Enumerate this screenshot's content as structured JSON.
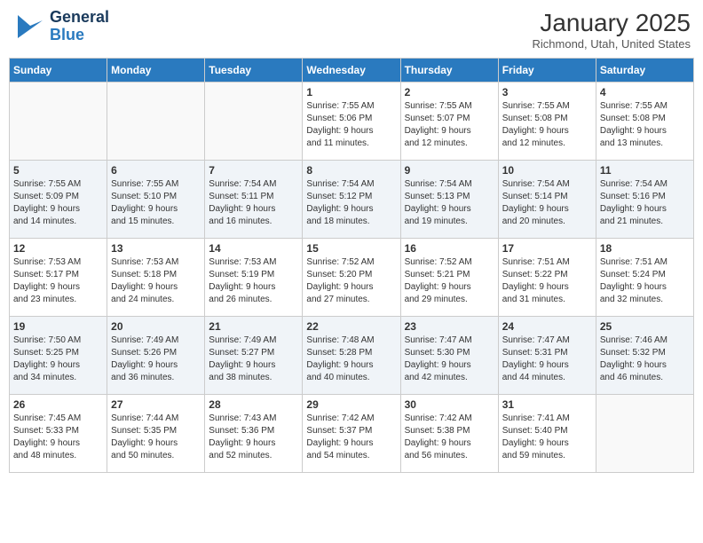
{
  "header": {
    "logo_line1": "General",
    "logo_line2": "Blue",
    "month": "January 2025",
    "location": "Richmond, Utah, United States"
  },
  "days_of_week": [
    "Sunday",
    "Monday",
    "Tuesday",
    "Wednesday",
    "Thursday",
    "Friday",
    "Saturday"
  ],
  "weeks": [
    [
      {
        "day": "",
        "info": ""
      },
      {
        "day": "",
        "info": ""
      },
      {
        "day": "",
        "info": ""
      },
      {
        "day": "1",
        "info": "Sunrise: 7:55 AM\nSunset: 5:06 PM\nDaylight: 9 hours\nand 11 minutes."
      },
      {
        "day": "2",
        "info": "Sunrise: 7:55 AM\nSunset: 5:07 PM\nDaylight: 9 hours\nand 12 minutes."
      },
      {
        "day": "3",
        "info": "Sunrise: 7:55 AM\nSunset: 5:08 PM\nDaylight: 9 hours\nand 12 minutes."
      },
      {
        "day": "4",
        "info": "Sunrise: 7:55 AM\nSunset: 5:08 PM\nDaylight: 9 hours\nand 13 minutes."
      }
    ],
    [
      {
        "day": "5",
        "info": "Sunrise: 7:55 AM\nSunset: 5:09 PM\nDaylight: 9 hours\nand 14 minutes."
      },
      {
        "day": "6",
        "info": "Sunrise: 7:55 AM\nSunset: 5:10 PM\nDaylight: 9 hours\nand 15 minutes."
      },
      {
        "day": "7",
        "info": "Sunrise: 7:54 AM\nSunset: 5:11 PM\nDaylight: 9 hours\nand 16 minutes."
      },
      {
        "day": "8",
        "info": "Sunrise: 7:54 AM\nSunset: 5:12 PM\nDaylight: 9 hours\nand 18 minutes."
      },
      {
        "day": "9",
        "info": "Sunrise: 7:54 AM\nSunset: 5:13 PM\nDaylight: 9 hours\nand 19 minutes."
      },
      {
        "day": "10",
        "info": "Sunrise: 7:54 AM\nSunset: 5:14 PM\nDaylight: 9 hours\nand 20 minutes."
      },
      {
        "day": "11",
        "info": "Sunrise: 7:54 AM\nSunset: 5:16 PM\nDaylight: 9 hours\nand 21 minutes."
      }
    ],
    [
      {
        "day": "12",
        "info": "Sunrise: 7:53 AM\nSunset: 5:17 PM\nDaylight: 9 hours\nand 23 minutes."
      },
      {
        "day": "13",
        "info": "Sunrise: 7:53 AM\nSunset: 5:18 PM\nDaylight: 9 hours\nand 24 minutes."
      },
      {
        "day": "14",
        "info": "Sunrise: 7:53 AM\nSunset: 5:19 PM\nDaylight: 9 hours\nand 26 minutes."
      },
      {
        "day": "15",
        "info": "Sunrise: 7:52 AM\nSunset: 5:20 PM\nDaylight: 9 hours\nand 27 minutes."
      },
      {
        "day": "16",
        "info": "Sunrise: 7:52 AM\nSunset: 5:21 PM\nDaylight: 9 hours\nand 29 minutes."
      },
      {
        "day": "17",
        "info": "Sunrise: 7:51 AM\nSunset: 5:22 PM\nDaylight: 9 hours\nand 31 minutes."
      },
      {
        "day": "18",
        "info": "Sunrise: 7:51 AM\nSunset: 5:24 PM\nDaylight: 9 hours\nand 32 minutes."
      }
    ],
    [
      {
        "day": "19",
        "info": "Sunrise: 7:50 AM\nSunset: 5:25 PM\nDaylight: 9 hours\nand 34 minutes."
      },
      {
        "day": "20",
        "info": "Sunrise: 7:49 AM\nSunset: 5:26 PM\nDaylight: 9 hours\nand 36 minutes."
      },
      {
        "day": "21",
        "info": "Sunrise: 7:49 AM\nSunset: 5:27 PM\nDaylight: 9 hours\nand 38 minutes."
      },
      {
        "day": "22",
        "info": "Sunrise: 7:48 AM\nSunset: 5:28 PM\nDaylight: 9 hours\nand 40 minutes."
      },
      {
        "day": "23",
        "info": "Sunrise: 7:47 AM\nSunset: 5:30 PM\nDaylight: 9 hours\nand 42 minutes."
      },
      {
        "day": "24",
        "info": "Sunrise: 7:47 AM\nSunset: 5:31 PM\nDaylight: 9 hours\nand 44 minutes."
      },
      {
        "day": "25",
        "info": "Sunrise: 7:46 AM\nSunset: 5:32 PM\nDaylight: 9 hours\nand 46 minutes."
      }
    ],
    [
      {
        "day": "26",
        "info": "Sunrise: 7:45 AM\nSunset: 5:33 PM\nDaylight: 9 hours\nand 48 minutes."
      },
      {
        "day": "27",
        "info": "Sunrise: 7:44 AM\nSunset: 5:35 PM\nDaylight: 9 hours\nand 50 minutes."
      },
      {
        "day": "28",
        "info": "Sunrise: 7:43 AM\nSunset: 5:36 PM\nDaylight: 9 hours\nand 52 minutes."
      },
      {
        "day": "29",
        "info": "Sunrise: 7:42 AM\nSunset: 5:37 PM\nDaylight: 9 hours\nand 54 minutes."
      },
      {
        "day": "30",
        "info": "Sunrise: 7:42 AM\nSunset: 5:38 PM\nDaylight: 9 hours\nand 56 minutes."
      },
      {
        "day": "31",
        "info": "Sunrise: 7:41 AM\nSunset: 5:40 PM\nDaylight: 9 hours\nand 59 minutes."
      },
      {
        "day": "",
        "info": ""
      }
    ]
  ]
}
